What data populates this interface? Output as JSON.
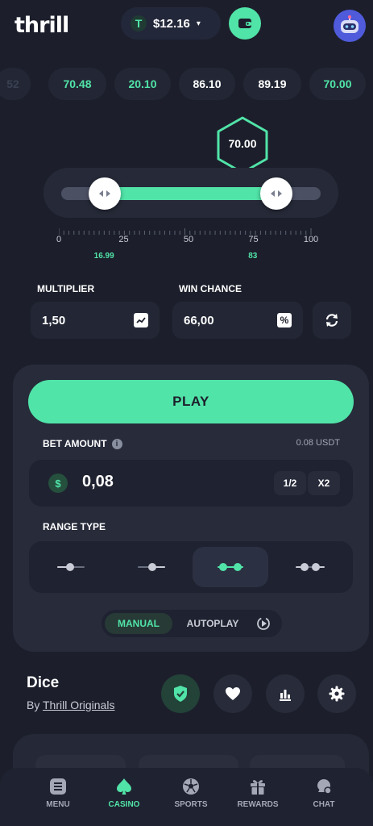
{
  "header": {
    "logo": "thrill",
    "currency_symbol": "T",
    "balance": "$12.16",
    "caret": "▾"
  },
  "history": [
    {
      "value": "52",
      "color": "faded"
    },
    {
      "value": "70.48",
      "color": "green"
    },
    {
      "value": "20.10",
      "color": "green"
    },
    {
      "value": "86.10",
      "color": "white"
    },
    {
      "value": "89.19",
      "color": "white"
    },
    {
      "value": "70.00",
      "color": "green"
    }
  ],
  "slider": {
    "result": "70.00",
    "lower": 16.99,
    "upper": 83,
    "lower_label": "16.99",
    "upper_label": "83",
    "ticks": [
      "0",
      "25",
      "50",
      "75",
      "100"
    ]
  },
  "multiplier": {
    "label": "MULTIPLIER",
    "value": "1,50"
  },
  "win_chance": {
    "label": "WIN CHANCE",
    "value": "66,00",
    "icon_text": "%"
  },
  "bet": {
    "play_label": "PLAY",
    "amount_label": "BET AMOUNT",
    "info": "i",
    "usdt": "0.08 USDT",
    "dollar": "$",
    "value": "0,08",
    "half": "1/2",
    "double": "X2"
  },
  "range": {
    "label": "RANGE TYPE",
    "active_index": 2
  },
  "modes": {
    "manual": "MANUAL",
    "autoplay": "AUTOPLAY"
  },
  "game": {
    "title": "Dice",
    "by_prefix": "By ",
    "provider": "Thrill Originals"
  },
  "nav": [
    {
      "label": "MENU"
    },
    {
      "label": "CASINO",
      "active": true
    },
    {
      "label": "SPORTS"
    },
    {
      "label": "REWARDS"
    },
    {
      "label": "CHAT"
    }
  ],
  "colors": {
    "accent": "#51e4a8",
    "background": "#1c1f2b",
    "panel": "#272b3a"
  }
}
